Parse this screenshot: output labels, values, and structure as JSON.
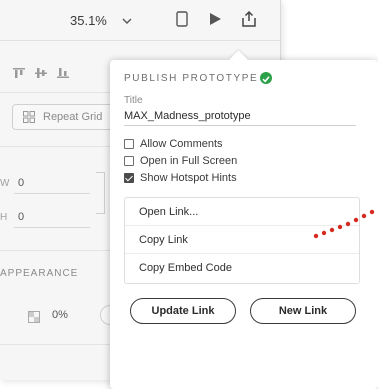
{
  "toolbar": {
    "zoom": "35.1%",
    "icons": [
      "chevron-down-icon",
      "device-icon",
      "play-icon",
      "share-icon"
    ]
  },
  "property_panel": {
    "repeat_grid_label": "Repeat Grid",
    "width_label": "W",
    "width_value": "0",
    "height_label": "H",
    "height_value": "0",
    "appearance_heading": "APPEARANCE",
    "opacity_value": "0%"
  },
  "popover": {
    "heading": "PUBLISH PROTOTYPE",
    "title_label": "Title",
    "title_value": "MAX_Madness_prototype",
    "options": [
      {
        "label": "Allow Comments",
        "checked": false
      },
      {
        "label": "Open in Full Screen",
        "checked": false
      },
      {
        "label": "Show Hotspot Hints",
        "checked": true
      }
    ],
    "link_items": [
      "Open Link...",
      "Copy Link",
      "Copy Embed Code"
    ],
    "update_button": "Update Link",
    "new_button": "New Link"
  },
  "colors": {
    "accent_green": "#2ca14a",
    "annotation_red": "#d42a1f"
  }
}
